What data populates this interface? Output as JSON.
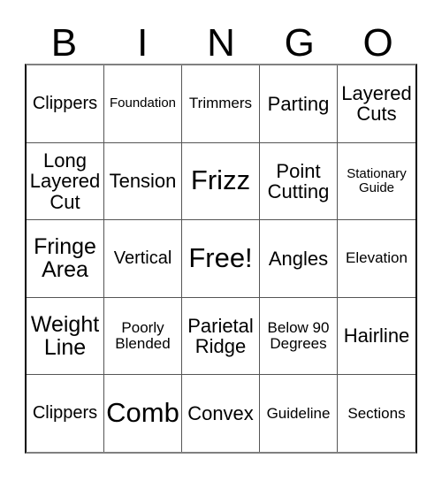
{
  "card": {
    "header_letters": [
      "B",
      "I",
      "N",
      "G",
      "O"
    ],
    "columns": 5,
    "rows": 5,
    "colors": {
      "text": "#000000",
      "background": "#ffffff",
      "grid_line": "#555555",
      "outer_border": "#000000"
    },
    "cells": [
      [
        {
          "label": "Clippers",
          "size": "md"
        },
        {
          "label": "Foundation",
          "size": "xs"
        },
        {
          "label": "Trimmers",
          "size": "sm"
        },
        {
          "label": "Parting",
          "size": "lg"
        },
        {
          "label": "Layered Cuts",
          "size": "lg"
        }
      ],
      [
        {
          "label": "Long Layered Cut",
          "size": "lg"
        },
        {
          "label": "Tension",
          "size": "lg"
        },
        {
          "label": "Frizz",
          "size": "xxl"
        },
        {
          "label": "Point Cutting",
          "size": "lg"
        },
        {
          "label": "Stationary Guide",
          "size": "xs"
        }
      ],
      [
        {
          "label": "Fringe Area",
          "size": "xl"
        },
        {
          "label": "Vertical",
          "size": "md"
        },
        {
          "label": "Free!",
          "size": "xxl"
        },
        {
          "label": "Angles",
          "size": "lg"
        },
        {
          "label": "Elevation",
          "size": "sm"
        }
      ],
      [
        {
          "label": "Weight Line",
          "size": "xl"
        },
        {
          "label": "Poorly Blended",
          "size": "sm"
        },
        {
          "label": "Parietal Ridge",
          "size": "lg"
        },
        {
          "label": "Below 90 Degrees",
          "size": "sm"
        },
        {
          "label": "Hairline",
          "size": "lg"
        }
      ],
      [
        {
          "label": "Clippers",
          "size": "md"
        },
        {
          "label": "Comb",
          "size": "xxl"
        },
        {
          "label": "Convex",
          "size": "lg"
        },
        {
          "label": "Guideline",
          "size": "sm"
        },
        {
          "label": "Sections",
          "size": "sm"
        }
      ]
    ]
  }
}
